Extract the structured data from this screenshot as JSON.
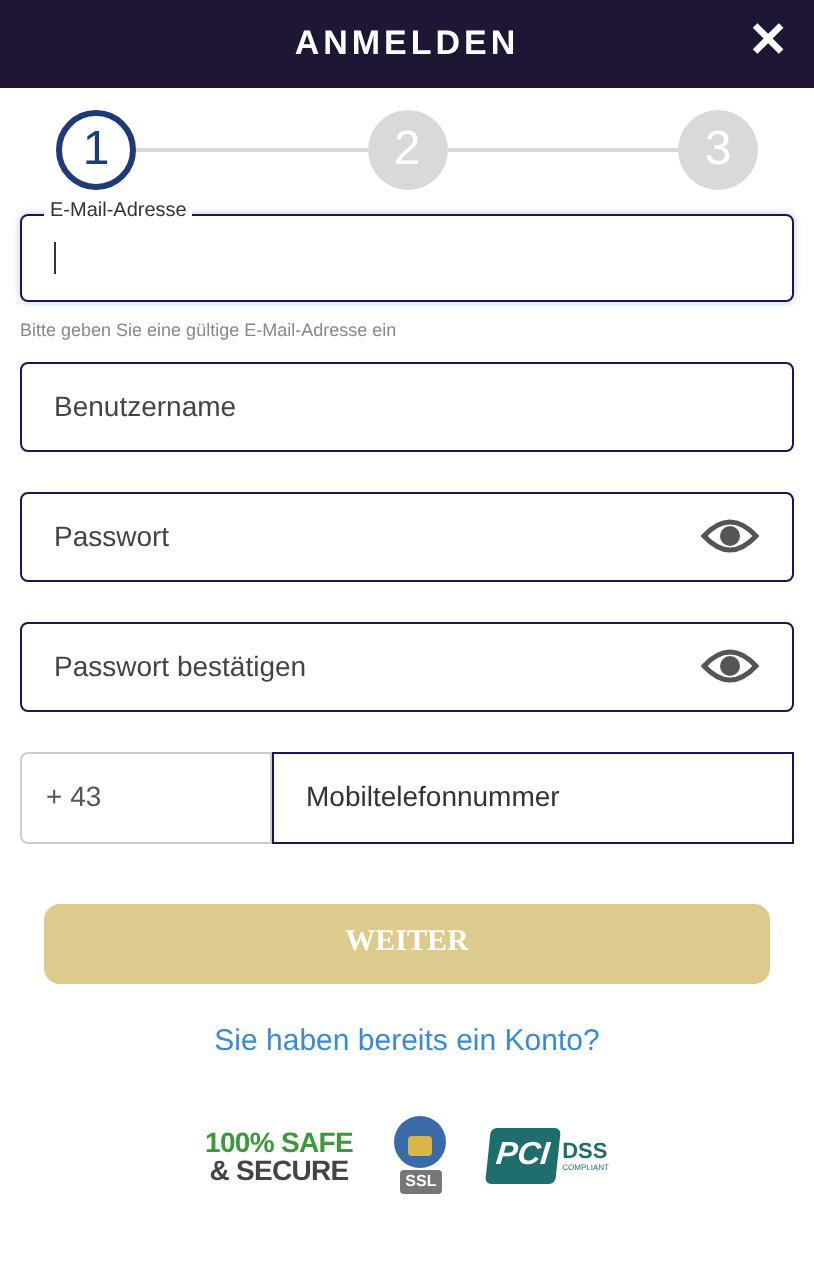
{
  "header": {
    "title": "ANMELDEN",
    "close": "✕"
  },
  "steps": [
    {
      "label": "1",
      "selected": true
    },
    {
      "label": "2",
      "selected": false
    },
    {
      "label": "3",
      "selected": false
    }
  ],
  "email": {
    "label": "E-Mail-Adresse",
    "focused": true,
    "hint": "Bitte geben Sie eine gültige E-Mail-Adresse ein"
  },
  "fields": [
    {
      "kind": "text",
      "placeholder": "Benutzername"
    },
    {
      "kind": "password",
      "placeholder": "Passwort"
    },
    {
      "kind": "password",
      "placeholder": "Passwort bestätigen"
    }
  ],
  "phone": {
    "prefix": "+ 43",
    "placeholder": "Mobiltelefonnummer"
  },
  "submit": {
    "label": "WEITER",
    "disabled": true
  },
  "login_link": "Sie haben bereits ein Konto?",
  "badges": {
    "safe": [
      "100% SAFE",
      "& SECURE"
    ],
    "ssl": "SSL",
    "pci": {
      "logo": "PCI",
      "dss": "DSS",
      "compliant": "COMPLIANT"
    }
  }
}
